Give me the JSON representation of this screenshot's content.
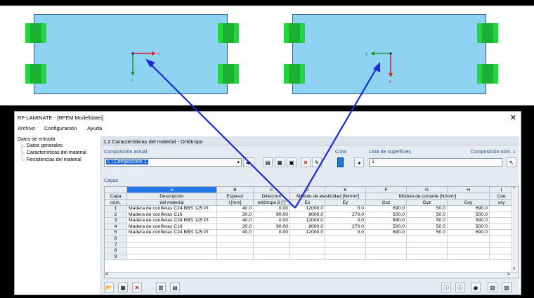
{
  "top_view": {
    "left_panel": {
      "axis_x": "x",
      "axis_y": "y"
    },
    "right_panel": {
      "axis_x": "x",
      "axis_y": "y"
    }
  },
  "window": {
    "title": "RF-LAMINATE - [RFEM Modelldatei]",
    "close": "✕",
    "menu": [
      "Archivo",
      "Configuración",
      "Ayuda"
    ]
  },
  "tree": {
    "root": "Datos de entrada",
    "items": [
      "Datos generales",
      "Características del material",
      "Resistencias del material"
    ]
  },
  "section": {
    "title": "1.2 Características del material - Ortótropo",
    "composicion_label": "Composición actual",
    "composicion_value": "L | Composición 1",
    "color_label": "Color",
    "lista_label": "Lista de superficies",
    "lista_value": "1",
    "comp_num_label": "Composición núm. 1",
    "capas_label": "Capas"
  },
  "table": {
    "col_letters": [
      "A",
      "B",
      "C",
      "D",
      "E",
      "F",
      "G",
      "H",
      "I"
    ],
    "header_row1": [
      "Capa",
      "Descripción",
      "Espesor",
      "Dirección",
      "Módulo de elasticidad [N/mm²]",
      "",
      "Módulo de cortante [N/mm²]",
      "",
      "",
      "Coe"
    ],
    "header_row2": [
      "núm.",
      "del material",
      "t [mm]",
      "ortótropa β [°]",
      "Ex",
      "Ey",
      "Gxz",
      "Gyz",
      "Gxy",
      "νxy"
    ],
    "rows": [
      [
        "1",
        "Madera de coníferas C24 BBS 125 PI",
        "40.0",
        "0.00",
        "12000.0",
        "0.0",
        "690.0",
        "50.0",
        "690.0"
      ],
      [
        "2",
        "Madera de coníferas C16",
        "20.0",
        "90.00",
        "8000.0",
        "270.0",
        "500.0",
        "50.0",
        "500.0"
      ],
      [
        "3",
        "Madera de coníferas C24 BBS 125 PI",
        "40.0",
        "0.00",
        "12000.0",
        "0.0",
        "690.0",
        "50.0",
        "690.0"
      ],
      [
        "4",
        "Madera de coníferas C16",
        "20.0",
        "90.00",
        "8000.0",
        "270.0",
        "500.0",
        "50.0",
        "500.0"
      ],
      [
        "5",
        "Madera de coníferas C24 BBS 125 PI",
        "40.0",
        "0.00",
        "12000.0",
        "0.0",
        "690.0",
        "50.0",
        "690.0"
      ],
      [
        "6",
        "",
        "",
        "",
        "",
        "",
        "",
        "",
        ""
      ],
      [
        "7",
        "",
        "",
        "",
        "",
        "",
        "",
        "",
        ""
      ],
      [
        "8",
        "",
        "",
        "",
        "",
        "",
        "",
        "",
        ""
      ],
      [
        "9",
        "",
        "",
        "",
        "",
        "",
        "",
        "",
        ""
      ]
    ]
  },
  "colors": {
    "selected_header": "#2477e8",
    "panel_fill": "#8fd3f3",
    "arrow": "#1a2bd6",
    "green": "#22d640"
  }
}
